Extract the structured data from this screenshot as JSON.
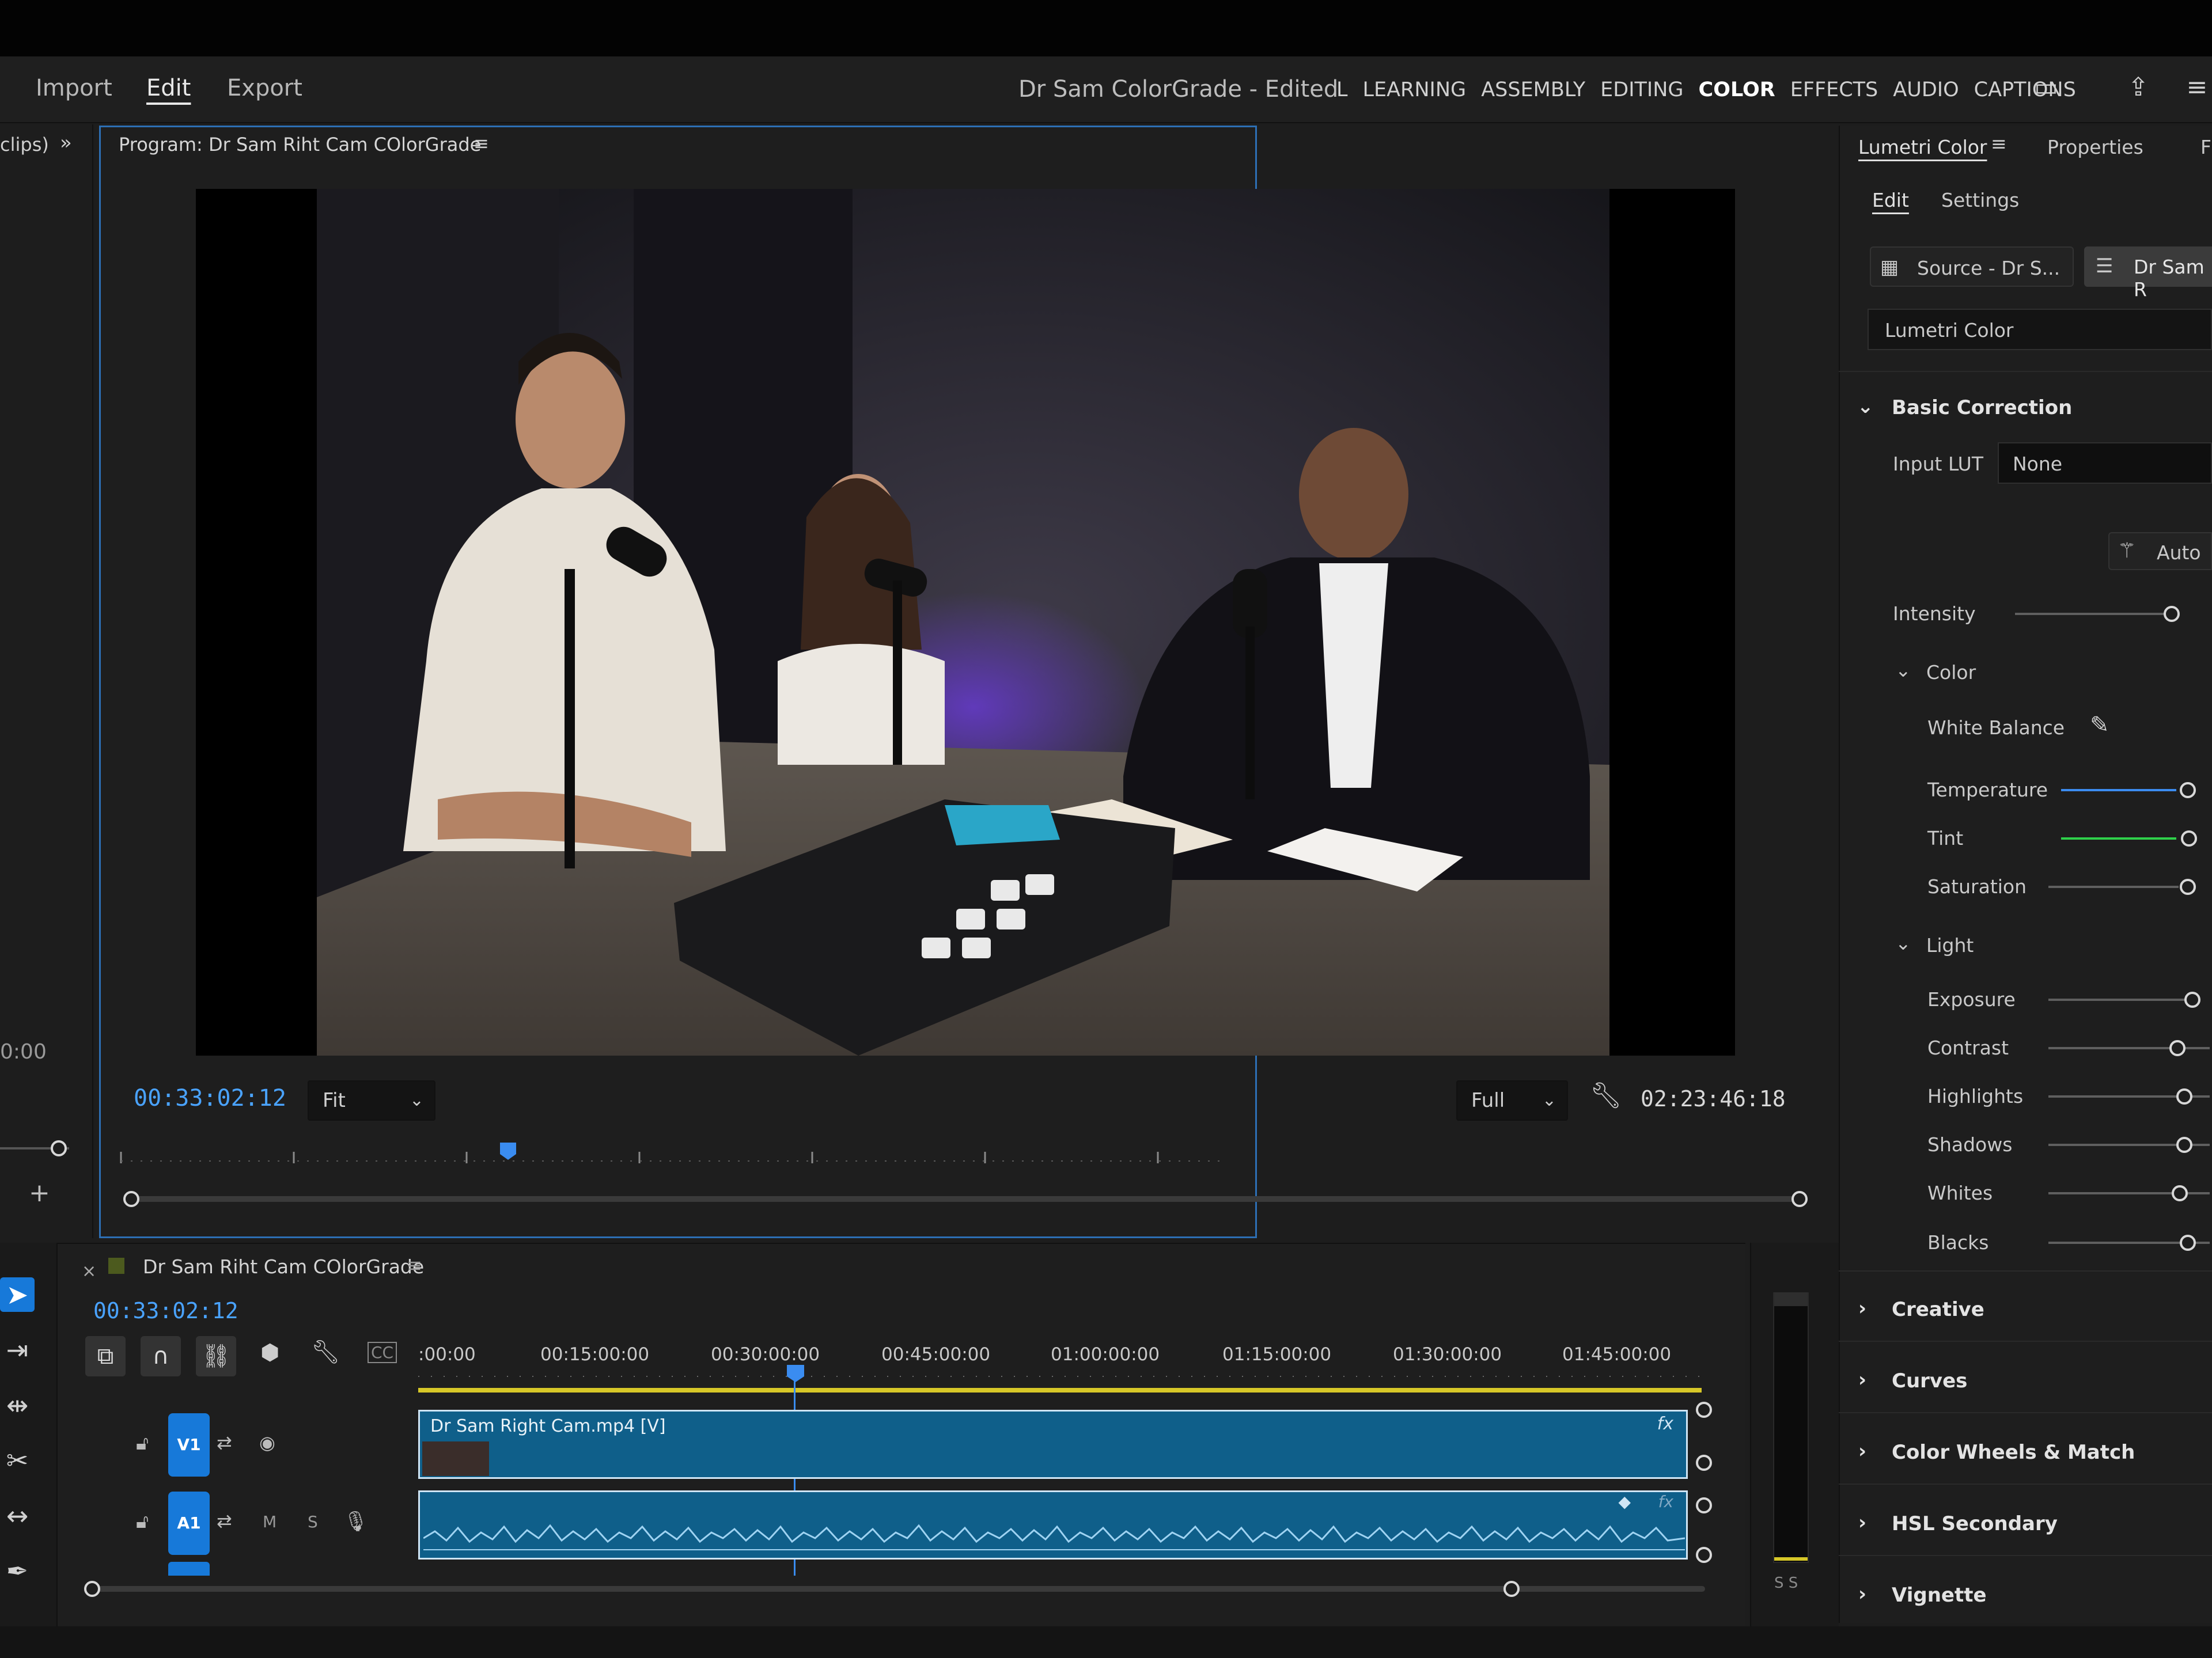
{
  "menu": {
    "import": "Import",
    "edit": "Edit",
    "export": "Export"
  },
  "document": {
    "title": "Dr Sam ColorGrade - Edited"
  },
  "workspaces": [
    "L",
    "LEARNING",
    "ASSEMBLY",
    "EDITING",
    "COLOR",
    "EFFECTS",
    "AUDIO",
    "CAPTIONS"
  ],
  "workspace_active": "COLOR",
  "left_panel": {
    "label": "clips)",
    "timecode": "0:00"
  },
  "program": {
    "title": "Program: Dr Sam Riht Cam COlorGrade",
    "timecode_current": "00:33:02:12",
    "zoom": "Fit",
    "quality": "Full",
    "timecode_duration": "02:23:46:18"
  },
  "lumetri": {
    "tab_lumetri": "Lumetri Color",
    "tab_properties": "Properties",
    "tab_more": "F",
    "subtab_edit": "Edit",
    "subtab_settings": "Settings",
    "source_label": "Source - Dr S...",
    "target_label": "Dr Sam R",
    "effect_name": "Lumetri Color",
    "basic_correction": "Basic Correction",
    "input_lut_label": "Input LUT",
    "input_lut_value": "None",
    "auto_label": "Auto",
    "intensity_label": "Intensity",
    "color_label": "Color",
    "white_balance_label": "White Balance",
    "temperature_label": "Temperature",
    "tint_label": "Tint",
    "saturation_label": "Saturation",
    "light_label": "Light",
    "exposure_label": "Exposure",
    "contrast_label": "Contrast",
    "highlights_label": "Highlights",
    "shadows_label": "Shadows",
    "whites_label": "Whites",
    "blacks_label": "Blacks",
    "sections": [
      "Creative",
      "Curves",
      "Color Wheels & Match",
      "HSL Secondary",
      "Vignette"
    ]
  },
  "timeline": {
    "sequence_name": "Dr Sam Riht Cam COlorGrade",
    "timecode": "00:33:02:12",
    "ruler": [
      ":00:00",
      "00:15:00:00",
      "00:30:00:00",
      "00:45:00:00",
      "01:00:00:00",
      "01:15:00:00",
      "01:30:00:00",
      "01:45:00:00"
    ],
    "video_track": "V1",
    "audio_track": "A1",
    "video_clip": "Dr Sam Right Cam.mp4 [V]",
    "fx": "fx",
    "mute": "M",
    "solo": "S",
    "meter_labels": "S S"
  },
  "colors": {
    "accent_blue": "#4aa3ff",
    "clip_blue": "#0f5f8a",
    "track_blue": "#1779d9",
    "panel_border": "#2d6fb4"
  }
}
